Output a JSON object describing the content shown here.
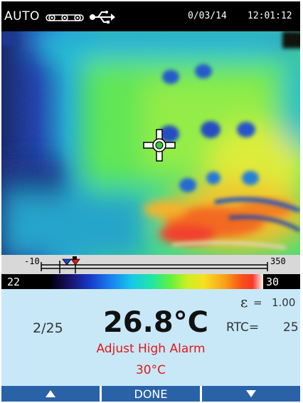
{
  "status_bar": {
    "mode": "AUTO",
    "sd_icon": "sd-card-icon",
    "usb_icon": "usb-icon",
    "date": "0/03/14",
    "time": "12:01:12"
  },
  "scale": {
    "range_min": "-10",
    "range_max": "350",
    "span_low": "22",
    "span_high": "30",
    "palette": "iron-rainbow"
  },
  "info": {
    "image_count": "2/25",
    "center_temperature": "26.8°C",
    "emissivity_symbol": "ε",
    "emissivity_eq": "=",
    "emissivity_value": "1.00",
    "rtc_label": "RTC=",
    "rtc_value": "25",
    "alarm_title": "Adjust High Alarm",
    "alarm_value": "30°C"
  },
  "softkeys": {
    "left_icon": "up-arrow-icon",
    "center_label": "DONE",
    "right_icon": "down-arrow-icon"
  },
  "colors": {
    "softkey_bar": "#2a62a8",
    "info_panel": "#c8e8f8",
    "alarm_text": "#e01818"
  }
}
